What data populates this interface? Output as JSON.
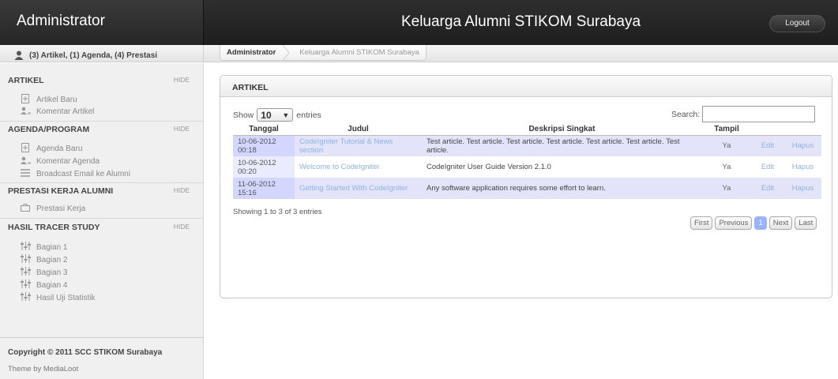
{
  "header": {
    "brand": "Administrator",
    "title": "Keluarga Alumni STIKOM Surabaya",
    "logout_label": "Logout"
  },
  "user_info": "(3) Artikel, (1) Agenda, (4) Prestasi",
  "breadcrumb": {
    "first": "Administrator",
    "second": "Keluarga Alumni STIKOM Surabaya"
  },
  "sidebar": {
    "hide_label": "HIDE",
    "sections": [
      {
        "title": "ARTIKEL",
        "items": [
          "Artikel Baru",
          "Komentar Artikel"
        ]
      },
      {
        "title": "AGENDA/PROGRAM",
        "items": [
          "Agenda Baru",
          "Komentar Agenda",
          "Broadcast Email ke Alumni"
        ]
      },
      {
        "title": "PRESTASI KERJA ALUMNI",
        "items": [
          "Prestasi Kerja"
        ]
      },
      {
        "title": "HASIL TRACER STUDY",
        "items": [
          "Bagian 1",
          "Bagian 2",
          "Bagian 3",
          "Bagian 4",
          "Hasil Uji Statistik"
        ]
      }
    ],
    "copyright": "Copyright © 2011 SCC STIKOM Surabaya",
    "theme": "Theme by MediaLoot"
  },
  "panel": {
    "title": "ARTIKEL",
    "show_label": "Show",
    "entries_value": "10",
    "entries_label": "entries",
    "search_label": "Search:",
    "search_value": "",
    "columns": [
      "Tanggal",
      "Judul",
      "Deskripsi Singkat",
      "Tampil"
    ],
    "rows": [
      {
        "date": "10-06-2012 00:18",
        "title": "CodeIgniter Tutorial & News section",
        "desc": "Test article. Test article. Test article. Test article. Test article. Test article. Test article.",
        "tampil": "Ya",
        "edit": "Edit",
        "hapus": "Hapus"
      },
      {
        "date": "10-06-2012 00:20",
        "title": "Welcome to CodeIgniter",
        "desc": "CodeIgniter User Guide Version 2.1.0",
        "tampil": "Ya",
        "edit": "Edit",
        "hapus": "Hapus"
      },
      {
        "date": "11-06-2012 15:16",
        "title": "Getting Started With CodeIgniter",
        "desc": "Any software application requires some effort to learn.",
        "tampil": "Ya",
        "edit": "Edit",
        "hapus": "Hapus"
      }
    ],
    "info": "Showing 1 to 3 of 3 entries",
    "pager": {
      "first": "First",
      "previous": "Previous",
      "page": "1",
      "next": "Next",
      "last": "Last"
    }
  }
}
